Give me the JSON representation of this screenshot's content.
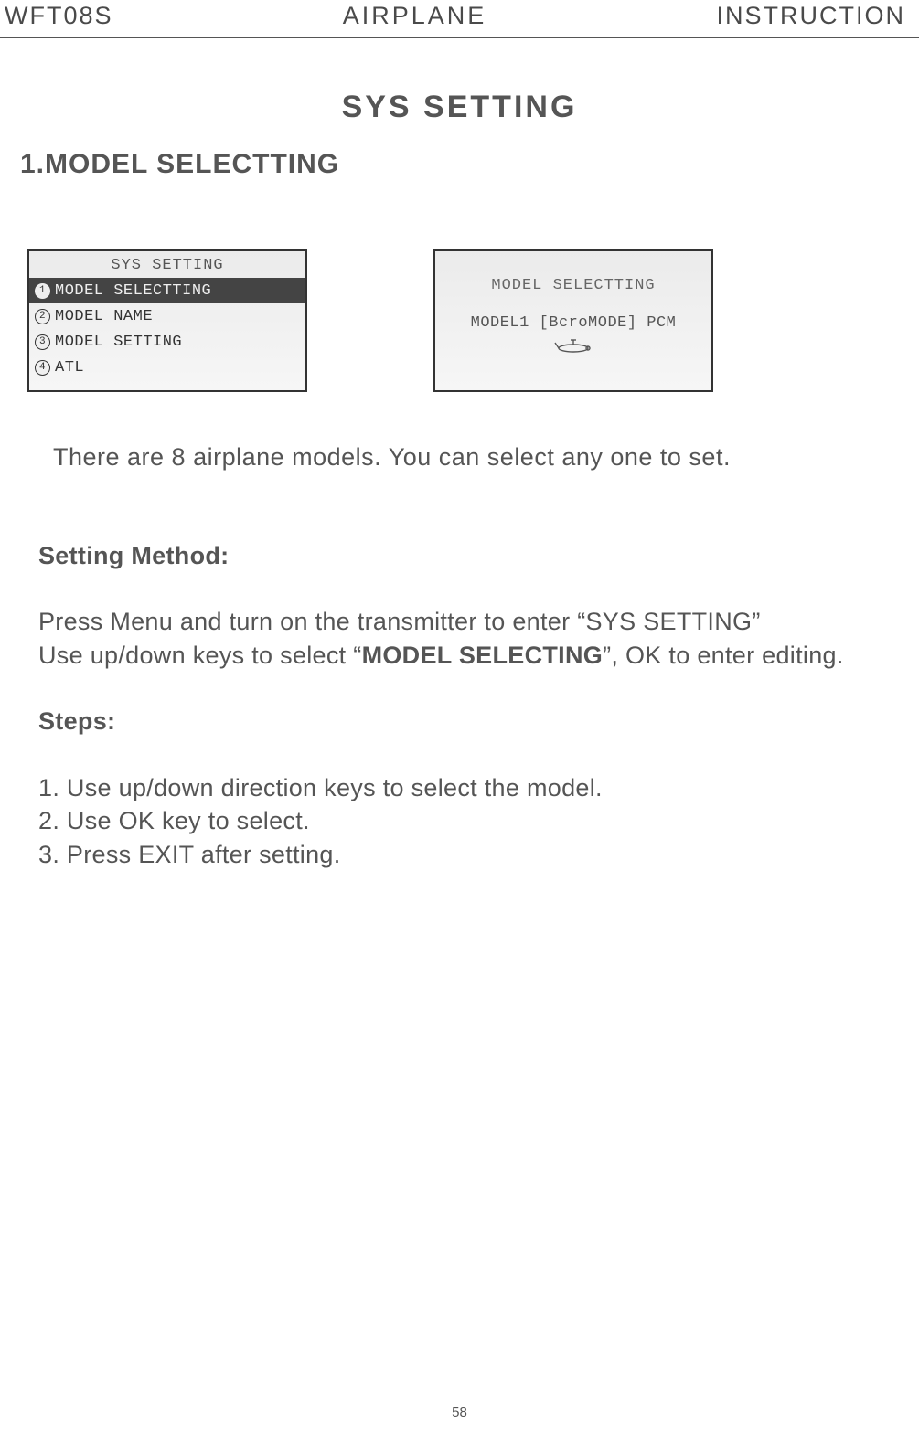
{
  "header": {
    "left": "WFT08S",
    "center": "AIRPLANE",
    "right": "INSTRUCTION"
  },
  "page_title": "SYS  SETTING",
  "section_title": "1.MODEL SELECTTING",
  "screen1": {
    "title": "SYS SETTING",
    "items": [
      {
        "num": "1",
        "label": "MODEL SELECTTING",
        "selected": true
      },
      {
        "num": "2",
        "label": "MODEL NAME",
        "selected": false
      },
      {
        "num": "3",
        "label": "MODEL SETTING",
        "selected": false
      },
      {
        "num": "4",
        "label": "ATL",
        "selected": false
      }
    ]
  },
  "screen2": {
    "title": "MODEL SELECTTING",
    "line": "MODEL1 [BcroMODE] PCM"
  },
  "intro": "There are 8  airplane models. You can select any one to set.",
  "setting_method_heading": "Setting Method:",
  "setting_method_p1a": "Press Menu and turn on the transmitter to enter “SYS SETTING”",
  "setting_method_p2_pre": "Use up/down keys to select “",
  "setting_method_p2_bold": "MODEL SELECTING",
  "setting_method_p2_post": "”, OK to enter editing.",
  "steps_heading": "Steps:",
  "steps": {
    "s1": "1. Use up/down direction keys to select the model.",
    "s2": "2. Use OK key to select.",
    "s3": "3. Press EXIT after setting."
  },
  "page_number": "58"
}
